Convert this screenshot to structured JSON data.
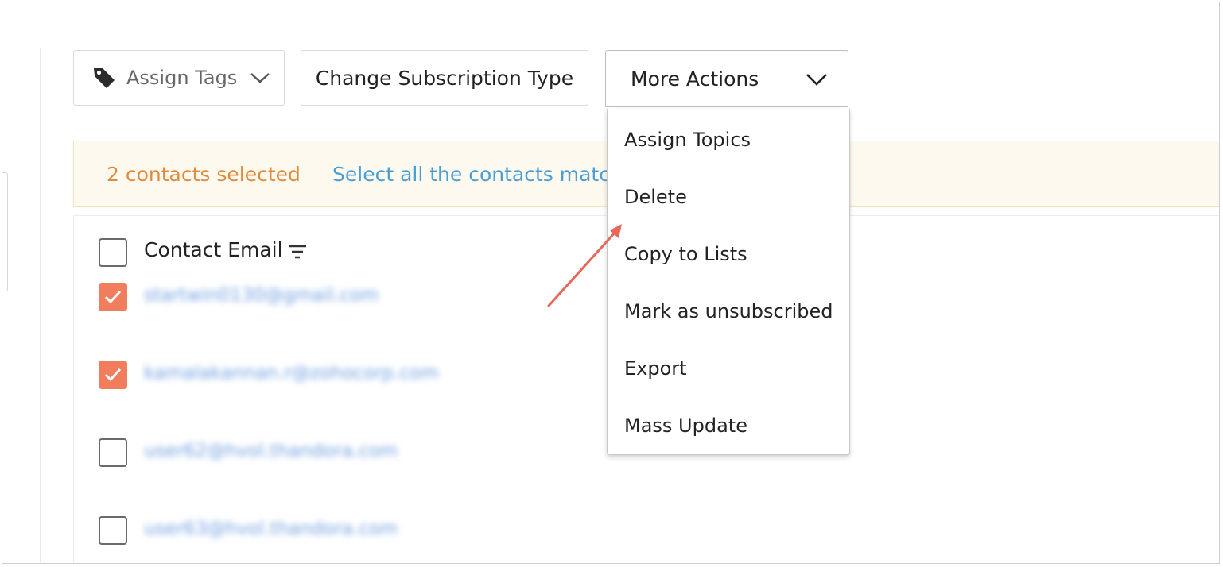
{
  "toolbar": {
    "assign_tags_label": "Assign Tags",
    "change_subscription_label": "Change Subscription Type",
    "more_actions_label": "More Actions"
  },
  "selection_banner": {
    "count_text": "2 contacts selected",
    "select_all_text": "Select all the contacts match"
  },
  "table": {
    "header_label": "Contact Email",
    "rows": [
      {
        "email": "startwin0130@gmail.com",
        "checked": true
      },
      {
        "email": "kamalakannan.r@zohocorp.com",
        "checked": true
      },
      {
        "email": "user62@hvol.thandora.com",
        "checked": false
      },
      {
        "email": "user63@hvol.thandora.com",
        "checked": false
      }
    ]
  },
  "more_actions_menu": {
    "items": [
      {
        "label": "Assign Topics"
      },
      {
        "label": "Delete"
      },
      {
        "label": "Copy to Lists"
      },
      {
        "label": "Mark as unsubscribed"
      },
      {
        "label": "Export"
      },
      {
        "label": "Mass Update"
      }
    ]
  },
  "colors": {
    "accent_orange": "#e08a3c",
    "checkbox_checked": "#f07d5c",
    "link_blue": "#4b9ed4",
    "banner_bg": "#fef9ef",
    "annotation_arrow": "#e8665a"
  },
  "icons": {
    "tag": "tag-icon",
    "chevron": "chevron-down-icon",
    "filter": "filter-icon",
    "check": "check-icon"
  }
}
